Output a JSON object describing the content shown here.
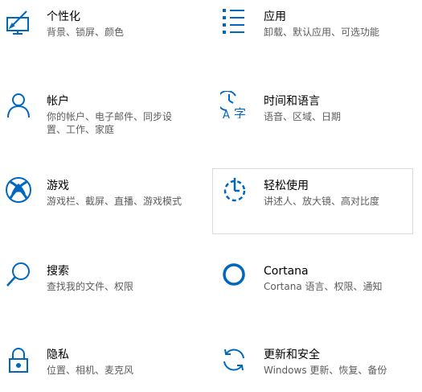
{
  "accent_color": "#0067c0",
  "tiles": [
    {
      "id": "personalization",
      "icon": "personalization-icon",
      "title": "个性化",
      "desc": [
        "背景、锁屏、颜色"
      ]
    },
    {
      "id": "apps",
      "icon": "apps-icon",
      "title": "应用",
      "desc": [
        "卸载、默认应用、可选功能"
      ]
    },
    {
      "id": "accounts",
      "icon": "account-icon",
      "title": "帐户",
      "desc": [
        "你的帐户、电子邮件、同步设",
        "置、工作、家庭"
      ]
    },
    {
      "id": "time-language",
      "icon": "time-language-icon",
      "title": "时间和语言",
      "desc": [
        "语音、区域、日期"
      ]
    },
    {
      "id": "gaming",
      "icon": "xbox-icon",
      "title": "游戏",
      "desc": [
        "游戏栏、截屏、直播、游戏模式"
      ]
    },
    {
      "id": "ease-of-access",
      "icon": "ease-of-access-icon",
      "title": "轻松使用",
      "desc": [
        "讲述人、放大镜、高对比度"
      ]
    },
    {
      "id": "search",
      "icon": "search-icon",
      "title": "搜索",
      "desc": [
        "查找我的文件、权限"
      ]
    },
    {
      "id": "cortana",
      "icon": "cortana-icon",
      "title": "Cortana",
      "desc": [
        "Cortana 语言、权限、通知"
      ]
    },
    {
      "id": "privacy",
      "icon": "lock-icon",
      "title": "隐私",
      "desc": [
        "位置、相机、麦克风"
      ]
    },
    {
      "id": "update-security",
      "icon": "sync-icon",
      "title": "更新和安全",
      "desc": [
        "Windows 更新、恢复、备份"
      ]
    }
  ]
}
